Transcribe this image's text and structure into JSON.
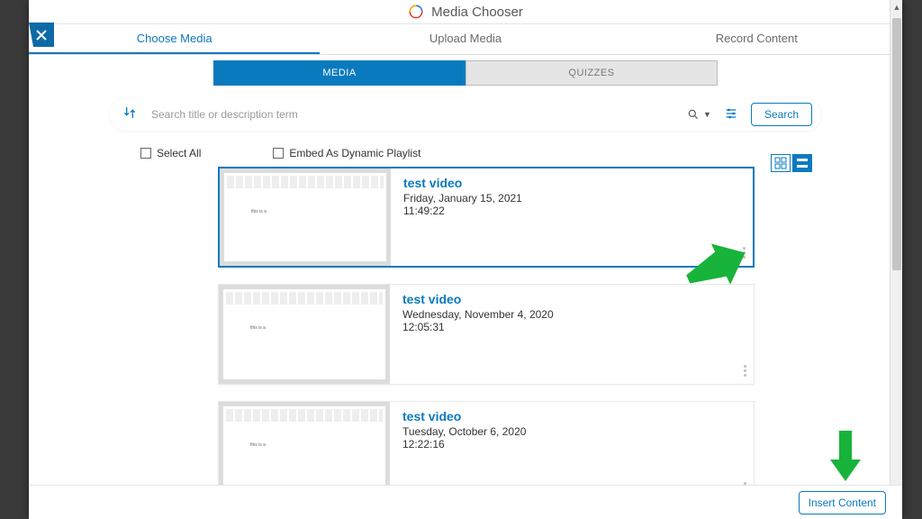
{
  "header": {
    "title": "Media Chooser"
  },
  "topTabs": {
    "choose": "Choose Media",
    "upload": "Upload Media",
    "record": "Record Content"
  },
  "subTabs": {
    "media": "MEDIA",
    "quizzes": "QUIZZES"
  },
  "search": {
    "placeholder": "Search title or description term",
    "button": "Search"
  },
  "checks": {
    "selectAll": "Select All",
    "dynamic": "Embed As Dynamic Playlist"
  },
  "items": [
    {
      "title": "test video",
      "date": "Friday, January 15, 2021",
      "time": "11:49:22",
      "doc": "this is a",
      "selected": true
    },
    {
      "title": "test video",
      "date": "Wednesday, November 4, 2020",
      "time": "12:05:31",
      "doc": "this is a",
      "selected": false
    },
    {
      "title": "test video",
      "date": "Tuesday, October 6, 2020",
      "time": "12:22:16",
      "doc": "this is a",
      "selected": false
    }
  ],
  "footer": {
    "insert": "Insert Content"
  }
}
